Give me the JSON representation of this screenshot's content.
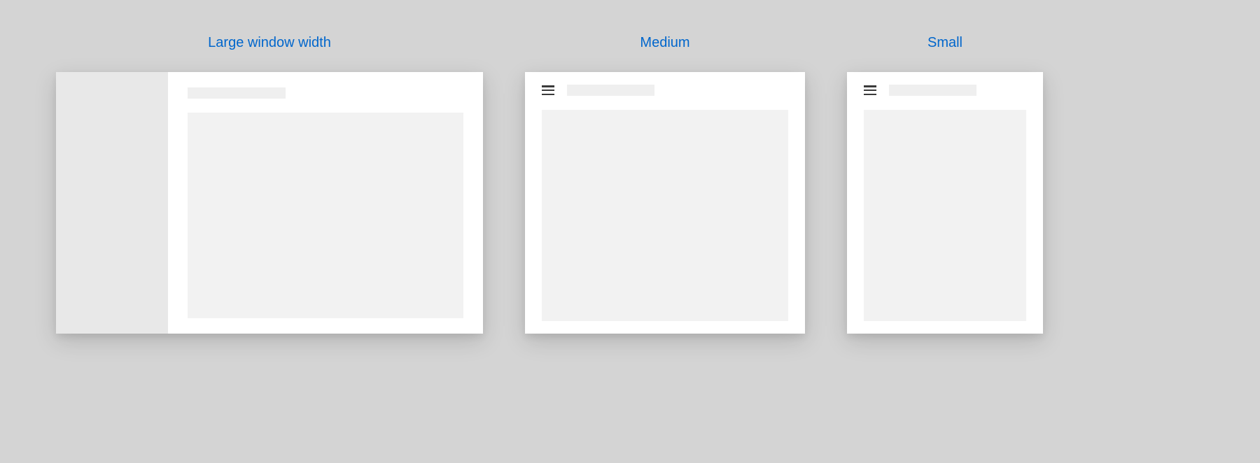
{
  "layouts": {
    "large": {
      "label": "Large window width"
    },
    "medium": {
      "label": "Medium"
    },
    "small": {
      "label": "Small"
    }
  },
  "colors": {
    "link_blue": "#0066cc",
    "page_bg": "#d4d4d4",
    "window_bg": "#ffffff",
    "sidebar_bg": "#e8e8e8",
    "placeholder_bg": "#f2f2f2"
  },
  "icons": {
    "hamburger": "hamburger-icon"
  }
}
